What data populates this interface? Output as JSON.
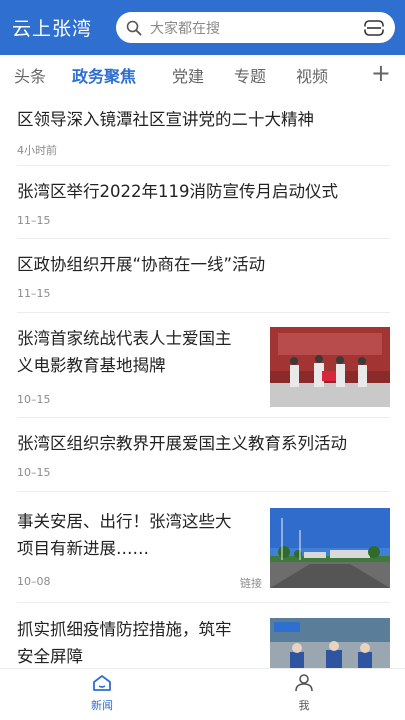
{
  "header": {
    "app_title": "云上张湾",
    "search_placeholder": "大家都在搜",
    "search_icon": "search-icon",
    "scan_icon": "scan-icon"
  },
  "tabs": [
    {
      "label": "头条",
      "active": false
    },
    {
      "label": "政务聚焦",
      "active": true
    },
    {
      "label": "党建",
      "active": false
    },
    {
      "label": "专题",
      "active": false
    },
    {
      "label": "视频",
      "active": false
    }
  ],
  "tab_add": "+",
  "feed": [
    {
      "title": "区领导深入镜潭社区宣讲党的二十大精神",
      "time": "4小时前"
    },
    {
      "title": "张湾区举行2022年119消防宣传月启动仪式",
      "time": "11–15"
    },
    {
      "title": "区政协组织开展“协商在一线”活动",
      "time": "11–15"
    },
    {
      "title": "张湾首家统战代表人士爱国主义电影教育基地揭牌",
      "time": "10–15"
    },
    {
      "title": "张湾区组织宗教界开展爱国主义教育系列活动",
      "time": "10–15"
    },
    {
      "title": "事关安居、出行！张湾这些大项目有新进展……",
      "time": "10–08",
      "tag": "链接"
    },
    {
      "title": "抓实抓细疫情防控措施，筑牢安全屏障",
      "time": ""
    }
  ],
  "bottom_nav": [
    {
      "label": "新闻",
      "icon": "home-icon",
      "active": true
    },
    {
      "label": "我",
      "icon": "user-icon",
      "active": false
    }
  ],
  "colors": {
    "brand": "#2f6fd0",
    "text": "#222222",
    "meta": "#8c8c8c"
  }
}
